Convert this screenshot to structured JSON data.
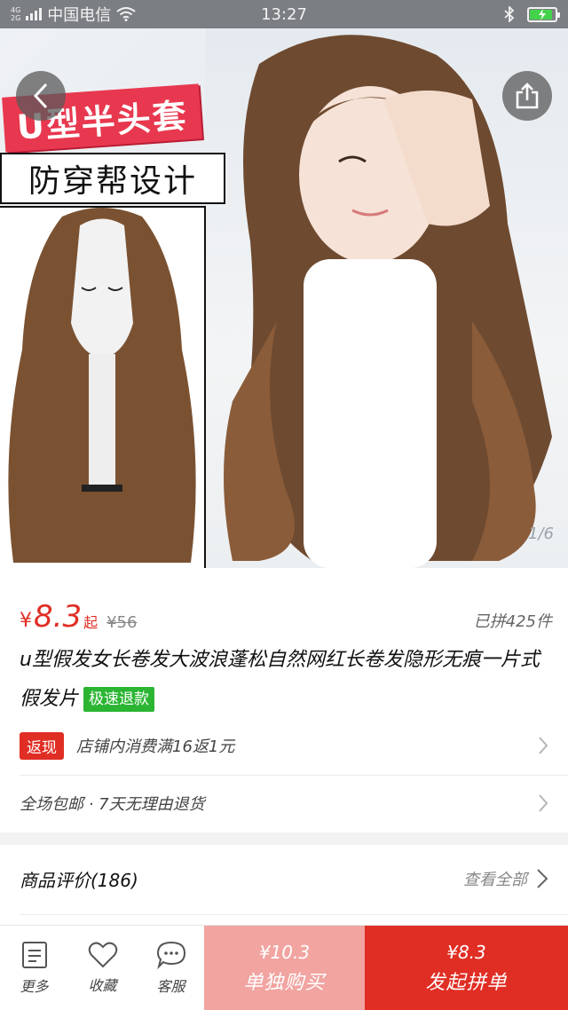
{
  "status_bar": {
    "net_type_top": "4G",
    "net_type_bottom": "2G",
    "carrier": "中国电信",
    "time": "13:27",
    "battery_level": 0.9
  },
  "hero": {
    "banner_top": "U型半头套",
    "banner_bottom": "防穿帮设计",
    "pager": "1/6"
  },
  "price": {
    "symbol": "¥",
    "value": "8.3",
    "suffix": "起",
    "original": "¥56",
    "sold": "已拼425件"
  },
  "product": {
    "title": "u型假发女长卷发大波浪蓬松自然网红长卷发隐形无痕一片式假发片",
    "badge": "极速退款"
  },
  "promo": {
    "tag": "返现",
    "text": "店铺内消费满16返1元"
  },
  "shipping": {
    "text": "全场包邮 · 7天无理由退货"
  },
  "reviews": {
    "title": "商品评价(186)",
    "link": "查看全部"
  },
  "bottom_bar": {
    "more_label": "更多",
    "fav_label": "收藏",
    "service_label": "客服",
    "alone_price": "¥10.3",
    "alone_label": "单独购买",
    "group_price": "¥8.3",
    "group_label": "发起拼单"
  },
  "colors": {
    "accent": "#e02e24",
    "accent_light": "#f1a4a0",
    "badge_green": "#2bb533"
  }
}
